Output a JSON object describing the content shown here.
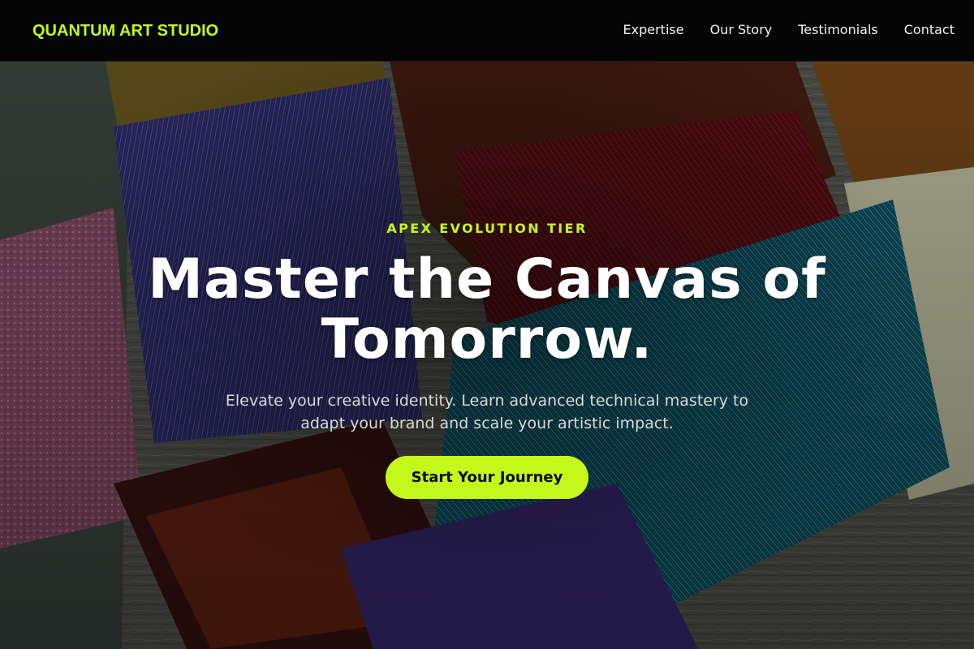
{
  "header": {
    "brand": "QUANTUM ART STUDIO",
    "nav": [
      {
        "label": "Expertise"
      },
      {
        "label": "Our Story"
      },
      {
        "label": "Testimonials"
      },
      {
        "label": "Contact"
      }
    ]
  },
  "hero": {
    "eyebrow": "APEX EVOLUTION TIER",
    "headline": "Master the Canvas of Tomorrow.",
    "subtext": "Elevate your creative identity. Learn advanced technical mastery to adapt your brand and scale your artistic impact.",
    "cta_label": "Start Your Journey",
    "background_image": "paint-brushes-photo"
  },
  "colors": {
    "accent": "#c4f81a",
    "nav_background": "#050505",
    "heading": "#ffffff",
    "body_text": "#d9d9d9"
  }
}
